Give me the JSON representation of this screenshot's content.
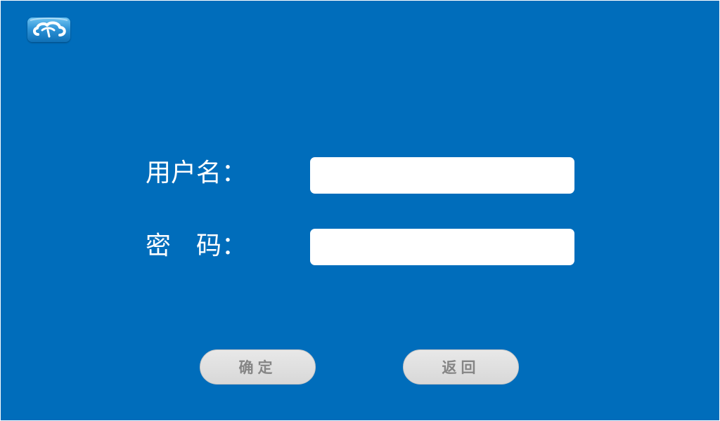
{
  "logo": {
    "icon": "cloud-icon"
  },
  "login_form": {
    "username": {
      "label": "用户名：",
      "value": "",
      "placeholder": ""
    },
    "password": {
      "label": "密　码：",
      "value": "",
      "placeholder": ""
    }
  },
  "actions": {
    "confirm_label": "确定",
    "back_label": "返回"
  },
  "colors": {
    "background": "#006dbb",
    "input_background": "#ffffff",
    "button_background": "#e3e3e3",
    "button_text": "#858585"
  }
}
